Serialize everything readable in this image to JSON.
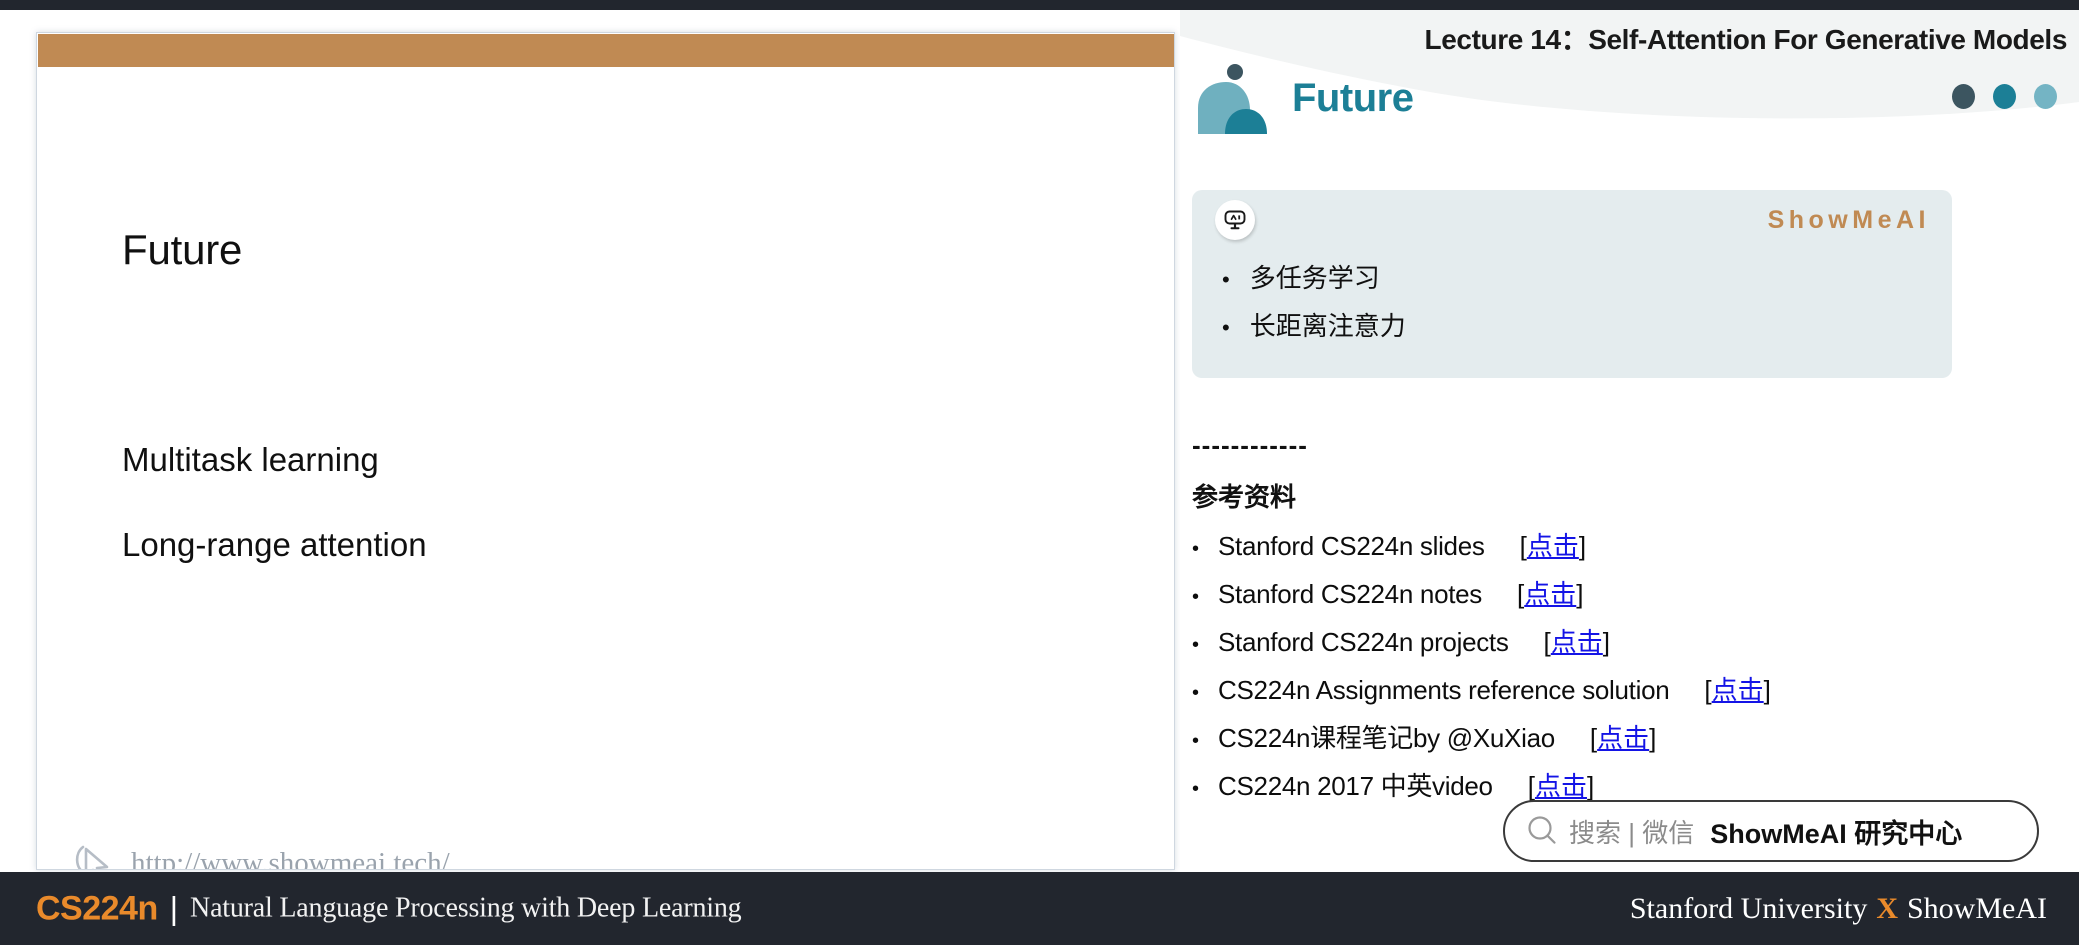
{
  "lecture": {
    "title": "Lecture 14：Self-Attention For Generative Models"
  },
  "slide": {
    "title": "Future",
    "lines": [
      "Multitask learning",
      "Long-range attention"
    ],
    "watermark_url": "http://www.showmeai.tech/",
    "accent_bar_color": "#c08a53"
  },
  "notes": {
    "logo_word": "Future",
    "logo_color": "#1c7f96",
    "dots": [
      {
        "name": "dot-dark",
        "color": "#3c5560"
      },
      {
        "name": "dot-teal",
        "color": "#1c7f96"
      },
      {
        "name": "dot-light",
        "color": "#74b4c4"
      }
    ],
    "callout": {
      "brand": "ShowMeAI",
      "brand_color": "#c08a53",
      "bg_color": "#e4ecee",
      "badge_icon": "ai-robot-icon",
      "bullets": [
        "多任务学习",
        "长距离注意力"
      ]
    },
    "divider": "------------",
    "refs_heading": "参考资料",
    "refs": [
      {
        "label": "Stanford CS224n slides",
        "link_open": "[",
        "link_text": "点击",
        "link_close": "]"
      },
      {
        "label": "Stanford CS224n notes",
        "link_open": "[",
        "link_text": "点击",
        "link_close": "]"
      },
      {
        "label": "Stanford CS224n projects",
        "link_open": "[",
        "link_text": "点击",
        "link_close": "]"
      },
      {
        "label": "CS224n Assignments reference solution",
        "link_open": "[",
        "link_text": "点击",
        "link_close": "]"
      },
      {
        "label": "CS224n课程笔记by @XuXiao",
        "link_open": "[",
        "link_text": "点击",
        "link_close": "]"
      },
      {
        "label": "CS224n 2017 中英video",
        "link_open": "[",
        "link_text": "点击",
        "link_close": "]"
      }
    ],
    "link_color": "#1414e6"
  },
  "search": {
    "icon": "search-icon",
    "placeholder": "搜索 | 微信",
    "brand": "ShowMeAI 研究中心"
  },
  "footer": {
    "course": "CS224n",
    "separator": "|",
    "subtitle": "Natural Language Processing with Deep Learning",
    "right_left": "Stanford University",
    "right_x": "X",
    "right_right": "ShowMeAI",
    "accent_color": "#e98a2b",
    "bg_color": "#22262e"
  }
}
